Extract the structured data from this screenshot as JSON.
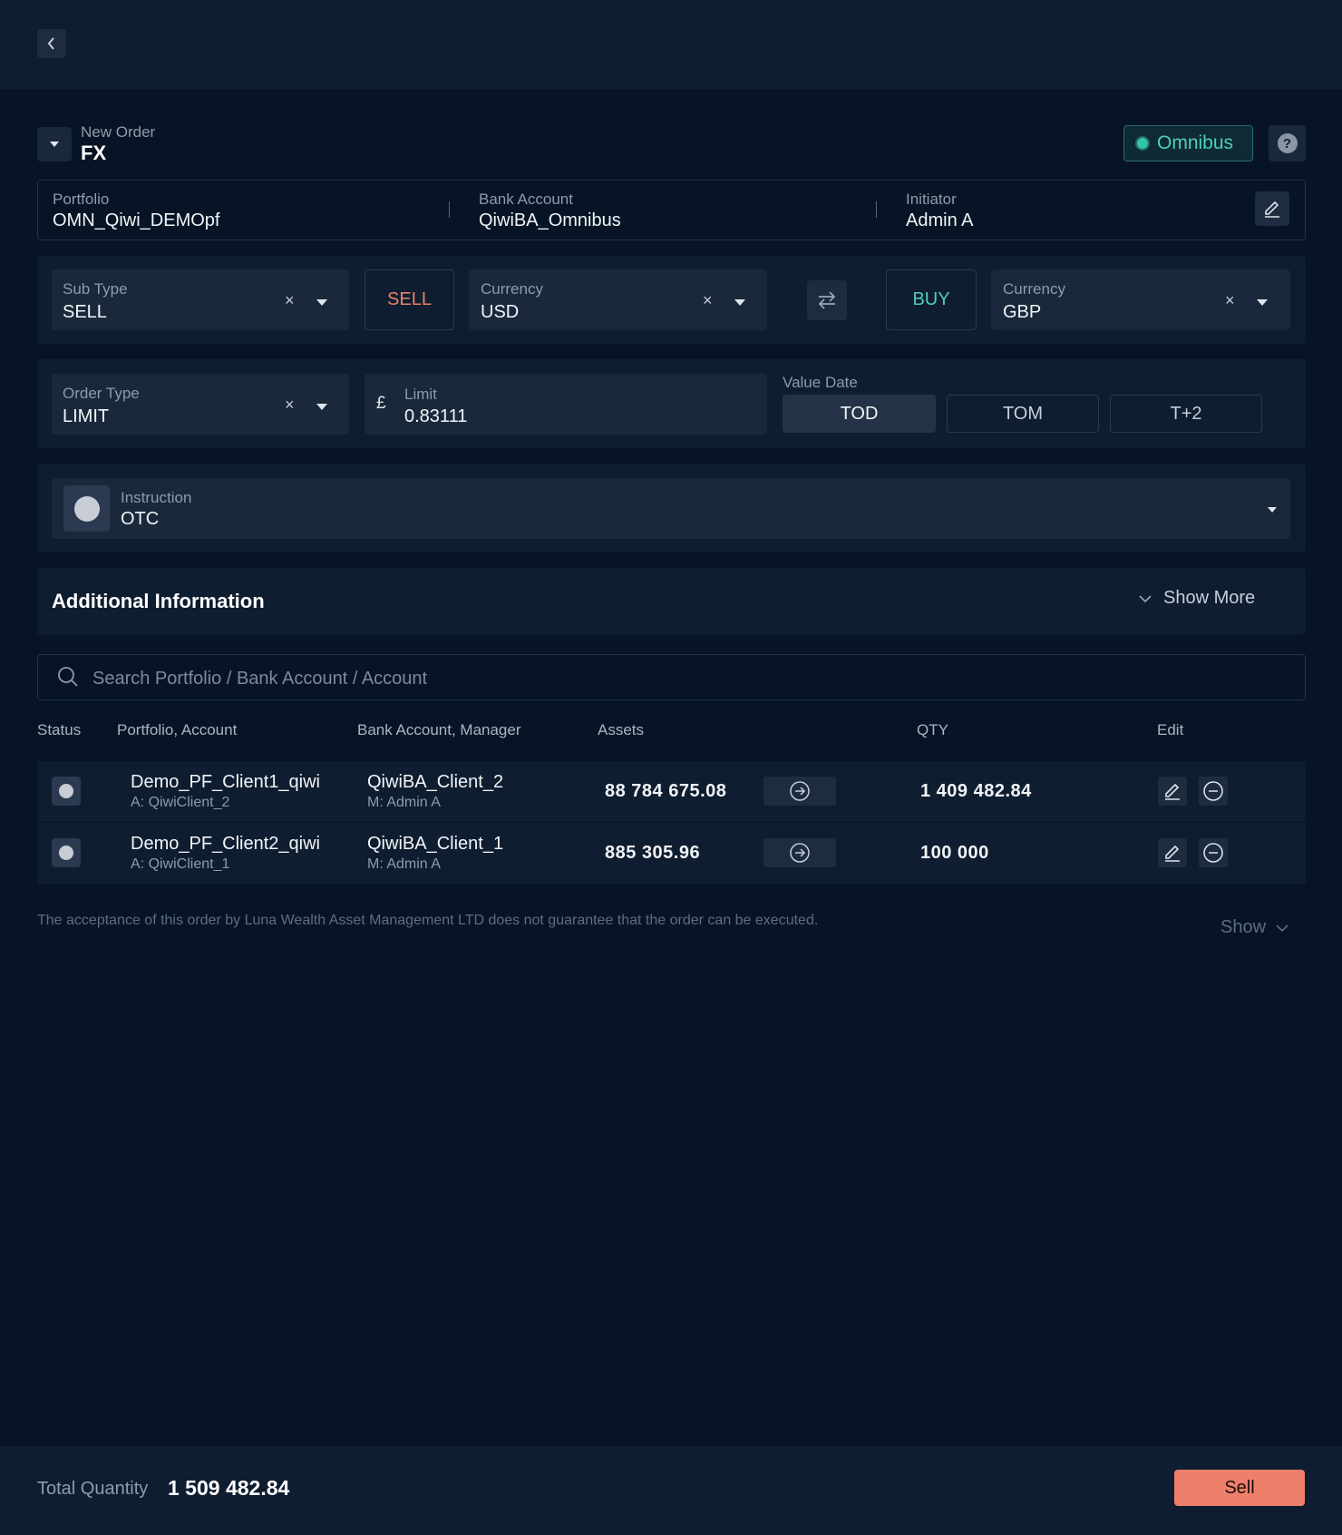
{
  "header": {
    "new_order_label": "New Order",
    "order_kind": "FX",
    "mode_badge": "Omnibus",
    "help_glyph": "?"
  },
  "info": {
    "portfolio_label": "Portfolio",
    "portfolio_value": "OMN_Qiwi_DEMOpf",
    "bank_label": "Bank Account",
    "bank_value": "QiwiBA_Omnibus",
    "initiator_label": "Initiator",
    "initiator_value": "Admin A"
  },
  "trade": {
    "subtype_label": "Sub Type",
    "subtype_value": "SELL",
    "sell_label": "SELL",
    "sell_currency_label": "Currency",
    "sell_currency_value": "USD",
    "buy_label": "BUY",
    "buy_currency_label": "Currency",
    "buy_currency_value": "GBP",
    "clear_glyph": "×"
  },
  "order": {
    "type_label": "Order Type",
    "type_value": "LIMIT",
    "limit_symbol": "£",
    "limit_label": "Limit",
    "limit_value": "0.83111",
    "value_date_label": "Value Date",
    "value_dates": [
      "TOD",
      "TOM",
      "T+2"
    ]
  },
  "instruction": {
    "label": "Instruction",
    "value": "OTC"
  },
  "additional": {
    "title": "Additional Information",
    "toggle": "Show More"
  },
  "search": {
    "placeholder": "Search Portfolio / Bank Account / Account"
  },
  "table": {
    "headers": [
      "Status",
      "Portfolio, Account",
      "Bank Account, Manager",
      "Assets",
      "QTY",
      "Edit"
    ],
    "rows": [
      {
        "portfolio": "Demo_PF_Client1_qiwi",
        "account": "A: QiwiClient_2",
        "bank": "QiwiBA_Client_2",
        "manager": "M: Admin A",
        "assets": "88 784 675.08",
        "qty": "1 409 482.84"
      },
      {
        "portfolio": "Demo_PF_Client2_qiwi",
        "account": "A: QiwiClient_1",
        "bank": "QiwiBA_Client_1",
        "manager": "M: Admin A",
        "assets": "885 305.96",
        "qty": "100 000"
      }
    ]
  },
  "disclaimer": {
    "text": "The acceptance of this order by Luna Wealth Asset Management LTD does not guarantee that the order can be executed.",
    "toggle": "Show"
  },
  "footer": {
    "total_label": "Total Quantity",
    "total_value": "1 509 482.84",
    "submit": "Sell"
  },
  "colors": {
    "background": "#061425",
    "panel": "#0f1d30",
    "sell_accent": "#ee7f6b",
    "buy_accent": "#4fd0b8"
  }
}
